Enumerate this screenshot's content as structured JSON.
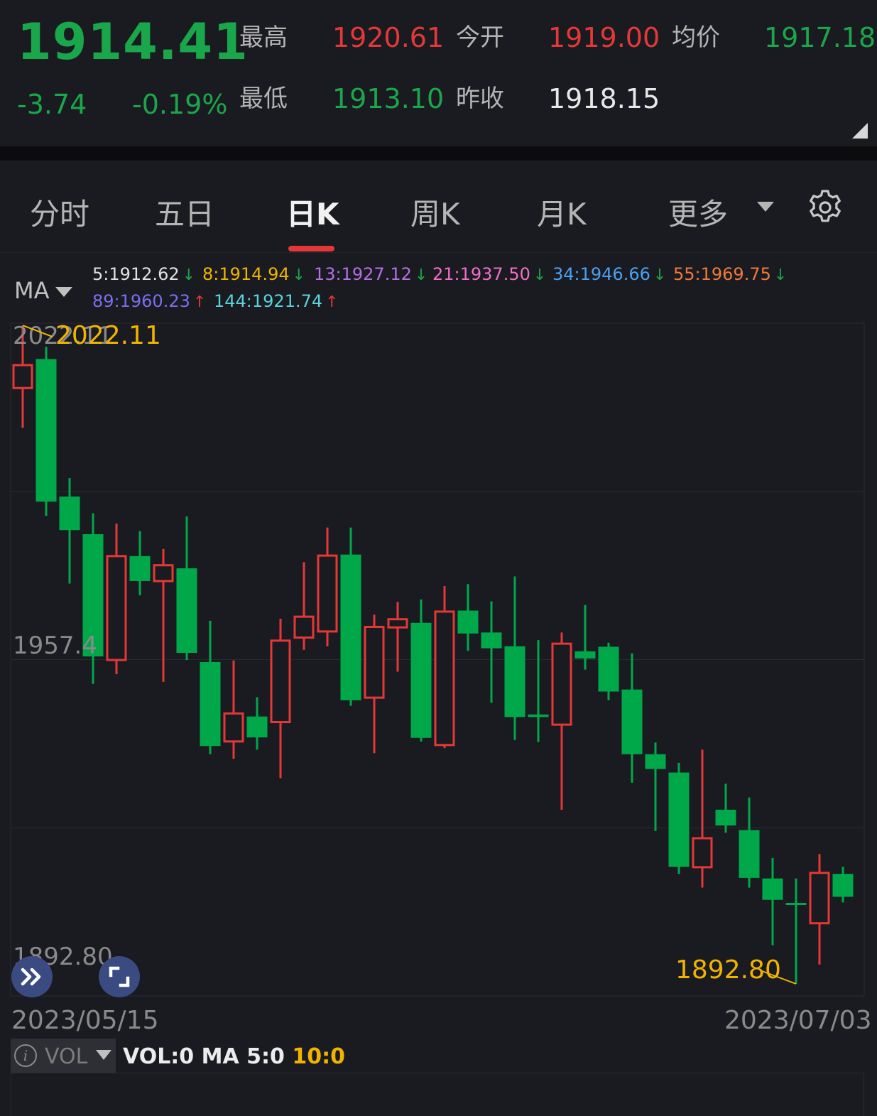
{
  "quote": {
    "price": "1914.41",
    "change": "-3.74",
    "change_pct": "-0.19%",
    "high_label": "最高",
    "high": "1920.61",
    "open_label": "今开",
    "open": "1919.00",
    "avg_label": "均价",
    "avg": "1917.18",
    "low_label": "最低",
    "low": "1913.10",
    "prev_close_label": "昨收",
    "prev_close": "1918.15"
  },
  "tabs": {
    "items": [
      {
        "label": "分时",
        "active": false
      },
      {
        "label": "五日",
        "active": false
      },
      {
        "label": "日K",
        "active": true
      },
      {
        "label": "周K",
        "active": false
      },
      {
        "label": "月K",
        "active": false
      }
    ],
    "more_label": "更多",
    "settings_icon": "gear-icon"
  },
  "ma_legend": {
    "selector_label": "MA",
    "items": [
      {
        "text": "5:1912.62",
        "color": "#e0e0e0",
        "dir": "down"
      },
      {
        "text": "8:1914.94",
        "color": "#f0b400",
        "dir": "down"
      },
      {
        "text": "13:1927.12",
        "color": "#b46ee6",
        "dir": "down"
      },
      {
        "text": "21:1937.50",
        "color": "#f06ec8",
        "dir": "down"
      },
      {
        "text": "34:1946.66",
        "color": "#4aa0f0",
        "dir": "down"
      },
      {
        "text": "55:1969.75",
        "color": "#f07a3c",
        "dir": "down"
      },
      {
        "text": "89:1960.23",
        "color": "#7a6ef0",
        "dir": "up"
      },
      {
        "text": "144:1921.74",
        "color": "#5ad2dc",
        "dir": "up"
      }
    ]
  },
  "chart_data": {
    "type": "candlestick",
    "y_axis_labels": [
      {
        "text": "2022.11",
        "value": 2022.11
      },
      {
        "text": "1957.4",
        "value": 1957.4
      },
      {
        "text": "1892.80",
        "value": 1892.8
      }
    ],
    "max_marker": "2022.11",
    "min_marker": "1892.80",
    "ylim": [
      1892.8,
      2022.11
    ],
    "grid": true,
    "x_start_label": "2023/05/15",
    "x_end_label": "2023/07/03",
    "candles": [
      {
        "open": 2009.8,
        "close": 2014.3,
        "high": 2022.1,
        "low": 2002.0
      },
      {
        "open": 2015.5,
        "close": 1987.5,
        "high": 2017.9,
        "low": 1984.7
      },
      {
        "open": 1988.5,
        "close": 1981.9,
        "high": 1992.1,
        "low": 1971.4
      },
      {
        "open": 1981.1,
        "close": 1957.1,
        "high": 1985.2,
        "low": 1951.7
      },
      {
        "open": 1956.4,
        "close": 1976.8,
        "high": 1983.2,
        "low": 1953.6
      },
      {
        "open": 1976.8,
        "close": 1971.9,
        "high": 1981.7,
        "low": 1969.1
      },
      {
        "open": 1971.9,
        "close": 1975.0,
        "high": 1978.2,
        "low": 1952.1
      },
      {
        "open": 1974.4,
        "close": 1957.8,
        "high": 1984.6,
        "low": 1956.4
      },
      {
        "open": 1956.0,
        "close": 1939.5,
        "high": 1964.1,
        "low": 1937.9
      },
      {
        "open": 1940.4,
        "close": 1945.9,
        "high": 1956.3,
        "low": 1937.0
      },
      {
        "open": 1945.3,
        "close": 1941.2,
        "high": 1949.1,
        "low": 1938.8
      },
      {
        "open": 1944.2,
        "close": 1960.2,
        "high": 1964.5,
        "low": 1933.2
      },
      {
        "open": 1960.8,
        "close": 1964.9,
        "high": 1975.6,
        "low": 1958.4
      },
      {
        "open": 1962.0,
        "close": 1976.9,
        "high": 1982.4,
        "low": 1959.1
      },
      {
        "open": 1977.1,
        "close": 1948.5,
        "high": 1982.4,
        "low": 1947.4
      },
      {
        "open": 1949.0,
        "close": 1962.9,
        "high": 1965.3,
        "low": 1938.1
      },
      {
        "open": 1962.8,
        "close": 1964.4,
        "high": 1967.8,
        "low": 1954.1
      },
      {
        "open": 1963.7,
        "close": 1941.1,
        "high": 1968.3,
        "low": 1940.4
      },
      {
        "open": 1939.7,
        "close": 1965.9,
        "high": 1970.9,
        "low": 1939.1
      },
      {
        "open": 1966.1,
        "close": 1961.6,
        "high": 1971.3,
        "low": 1958.2
      },
      {
        "open": 1961.8,
        "close": 1958.7,
        "high": 1967.9,
        "low": 1948.0
      },
      {
        "open": 1959.1,
        "close": 1945.2,
        "high": 1972.8,
        "low": 1940.7
      },
      {
        "open": 1945.7,
        "close": 1945.2,
        "high": 1960.3,
        "low": 1940.3
      },
      {
        "open": 1943.7,
        "close": 1959.6,
        "high": 1961.8,
        "low": 1927.0
      },
      {
        "open": 1958.1,
        "close": 1956.7,
        "high": 1967.2,
        "low": 1954.5
      },
      {
        "open": 1959.0,
        "close": 1950.2,
        "high": 1959.8,
        "low": 1948.5
      },
      {
        "open": 1950.6,
        "close": 1937.9,
        "high": 1957.7,
        "low": 1932.3
      },
      {
        "open": 1937.9,
        "close": 1935.0,
        "high": 1940.2,
        "low": 1922.8
      },
      {
        "open": 1934.3,
        "close": 1915.8,
        "high": 1936.2,
        "low": 1914.4
      },
      {
        "open": 1915.7,
        "close": 1921.4,
        "high": 1938.8,
        "low": 1911.7
      },
      {
        "open": 1927.0,
        "close": 1923.9,
        "high": 1932.1,
        "low": 1922.5
      },
      {
        "open": 1923.0,
        "close": 1913.6,
        "high": 1929.4,
        "low": 1911.7
      },
      {
        "open": 1913.5,
        "close": 1909.3,
        "high": 1917.5,
        "low": 1900.4
      },
      {
        "open": 1908.7,
        "close": 1908.3,
        "high": 1913.5,
        "low": 1892.8
      },
      {
        "open": 1904.7,
        "close": 1914.6,
        "high": 1918.3,
        "low": 1896.6
      },
      {
        "open": 1914.4,
        "close": 1909.9,
        "high": 1915.8,
        "low": 1908.8
      }
    ]
  },
  "vol": {
    "label": "VOL",
    "stats_prefix": "VOL:0 MA 5:0 ",
    "ma10": "10:0"
  },
  "colors": {
    "up": "#e43838",
    "down": "#00a84a",
    "marker": "#f0b400",
    "grid": "#2a2b30",
    "axis_text": "#8a8a8a"
  }
}
